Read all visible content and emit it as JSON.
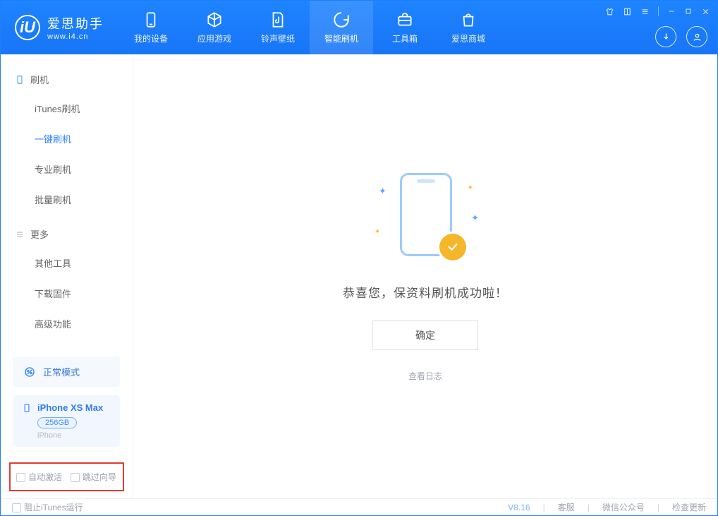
{
  "brand": {
    "name": "爱思助手",
    "url": "www.i4.cn"
  },
  "tabs": {
    "device": {
      "label": "我的设备"
    },
    "apps": {
      "label": "应用游戏"
    },
    "ring": {
      "label": "铃声壁纸"
    },
    "flash": {
      "label": "智能刷机"
    },
    "toolbox": {
      "label": "工具箱"
    },
    "store": {
      "label": "爱思商城"
    }
  },
  "sidebar": {
    "group_flash": "刷机",
    "group_more": "更多",
    "items": {
      "itunes": "iTunes刷机",
      "oneclick": "一键刷机",
      "pro": "专业刷机",
      "batch": "批量刷机",
      "other": "其他工具",
      "firmware": "下载固件",
      "advanced": "高级功能"
    },
    "mode_card": "正常模式",
    "device": {
      "name": "iPhone XS Max",
      "capacity": "256GB",
      "type": "iPhone"
    },
    "opt_auto_activate": "自动激活",
    "opt_skip_guide": "跳过向导"
  },
  "content": {
    "success_msg": "恭喜您，保资料刷机成功啦！",
    "ok_button": "确定",
    "view_log": "查看日志"
  },
  "statusbar": {
    "block_itunes": "阻止iTunes运行",
    "version": "V8.16",
    "support": "客服",
    "wechat": "微信公众号",
    "check_update": "检查更新"
  }
}
